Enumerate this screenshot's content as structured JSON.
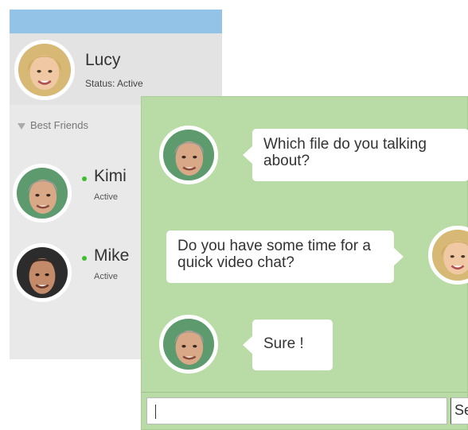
{
  "contacts_panel": {
    "user": {
      "name": "Lucy",
      "status": "Status: Active"
    },
    "group_label": "Best Friends",
    "friends": [
      {
        "name": "Kimi",
        "status": "Active"
      },
      {
        "name": "Mike",
        "status": "Active"
      }
    ]
  },
  "chat": {
    "messages": [
      {
        "from": "friend",
        "text": "Which file do you talking about?"
      },
      {
        "from": "me",
        "text": "Do you have some time for a quick video chat?"
      },
      {
        "from": "friend",
        "text": "Sure !"
      }
    ],
    "input": {
      "value": "",
      "placeholder": ""
    },
    "send_label": "Se"
  },
  "colors": {
    "top_bar": "#93c3e6",
    "chat_background": "#b9dba5",
    "online_dot": "#3bbf2b"
  }
}
